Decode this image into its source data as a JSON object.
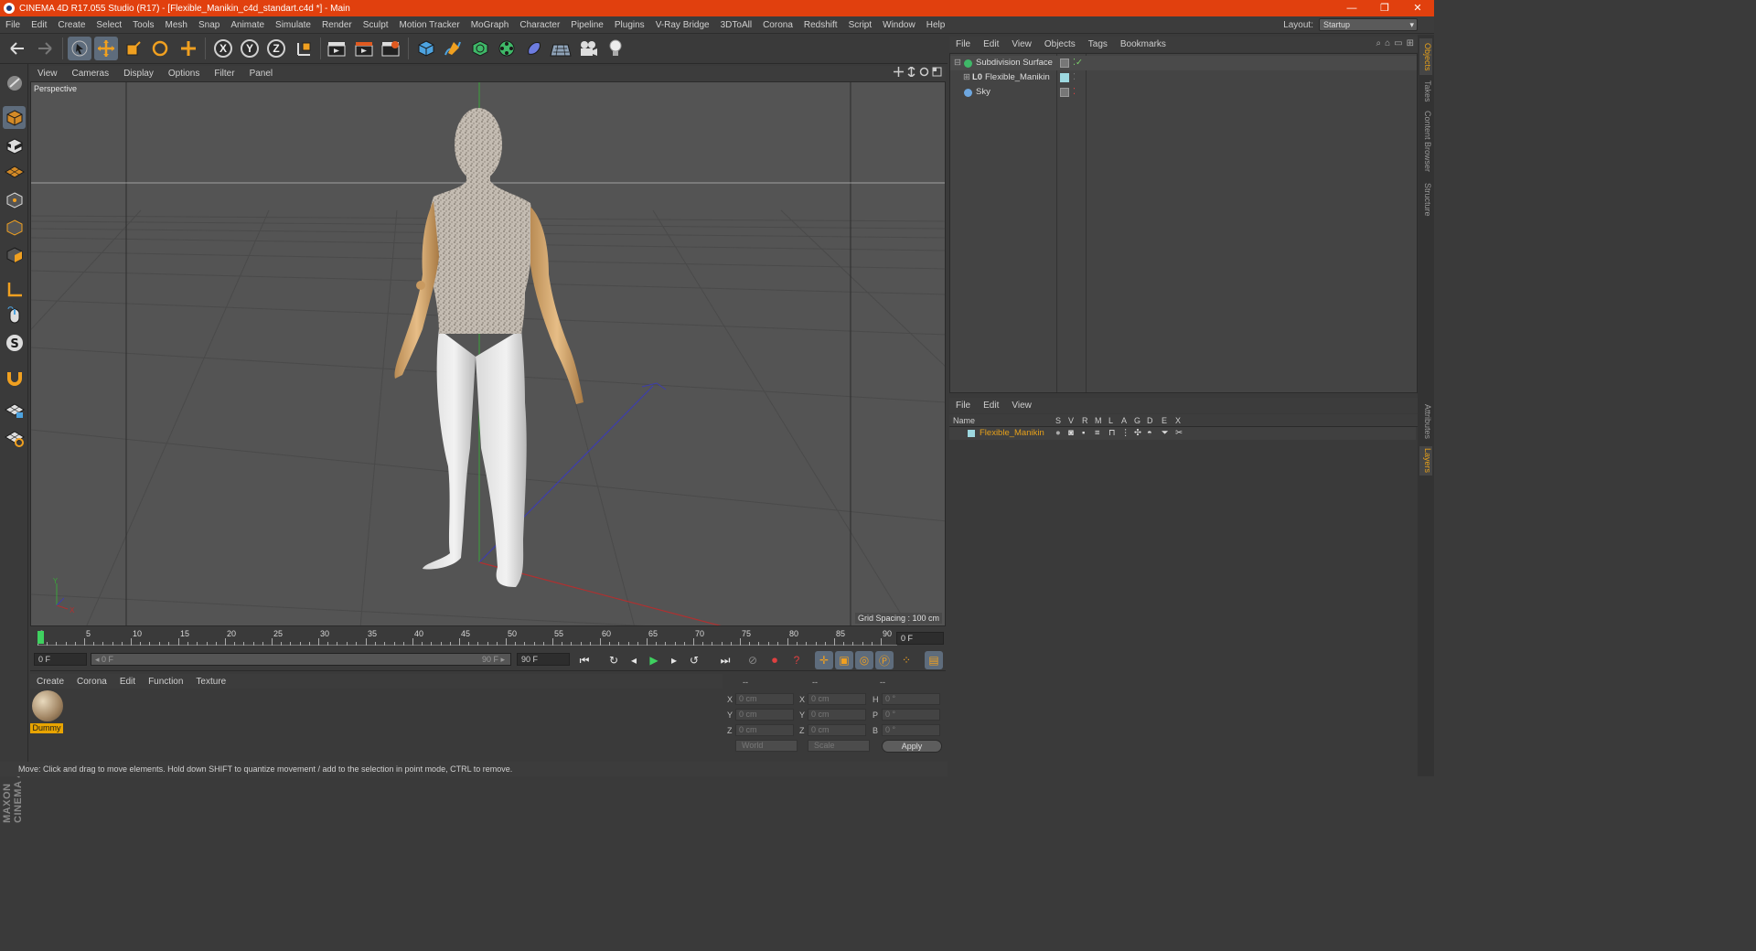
{
  "window": {
    "title": "CINEMA 4D R17.055 Studio (R17) - [Flexible_Manikin_c4d_standart.c4d *] - Main",
    "minimize": "—",
    "restore": "❐",
    "close": "✕"
  },
  "menu": [
    "File",
    "Edit",
    "Create",
    "Select",
    "Tools",
    "Mesh",
    "Snap",
    "Animate",
    "Simulate",
    "Render",
    "Sculpt",
    "Motion Tracker",
    "MoGraph",
    "Character",
    "Pipeline",
    "Plugins",
    "V-Ray Bridge",
    "3DToAll",
    "Corona",
    "Redshift",
    "Script",
    "Window",
    "Help"
  ],
  "layout": {
    "label": "Layout:",
    "value": "Startup"
  },
  "axis_buttons": [
    "X",
    "Y",
    "Z"
  ],
  "viewport": {
    "menu": [
      "View",
      "Cameras",
      "Display",
      "Options",
      "Filter",
      "Panel"
    ],
    "label": "Perspective",
    "grid_spacing": "Grid Spacing : 100 cm",
    "axis_y": "Y",
    "axis_x": "X"
  },
  "timeline": {
    "ticks": [
      "0",
      "5",
      "10",
      "15",
      "20",
      "25",
      "30",
      "35",
      "40",
      "45",
      "50",
      "55",
      "60",
      "65",
      "70",
      "75",
      "80",
      "85",
      "90"
    ],
    "current": "0 F"
  },
  "transport": {
    "start": "0 F",
    "range_start": "◂ 0 F",
    "range_end": "90 F ▸",
    "end": "90 F"
  },
  "material_manager": {
    "menu": [
      "Create",
      "Corona",
      "Edit",
      "Function",
      "Texture"
    ],
    "material": "Dummy"
  },
  "coordinates": {
    "header": [
      "--",
      "--",
      "--"
    ],
    "rows": [
      {
        "a": "X",
        "av": "0 cm",
        "b": "X",
        "bv": "0 cm",
        "c": "H",
        "cv": "0 °"
      },
      {
        "a": "Y",
        "av": "0 cm",
        "b": "Y",
        "bv": "0 cm",
        "c": "P",
        "cv": "0 °"
      },
      {
        "a": "Z",
        "av": "0 cm",
        "b": "Z",
        "bv": "0 cm",
        "c": "B",
        "cv": "0 °"
      }
    ],
    "space": "World",
    "mode": "Scale",
    "apply": "Apply"
  },
  "status": "Move: Click and drag to move elements. Hold down SHIFT to quantize movement / add to the selection in point mode, CTRL to remove.",
  "branding": "MAXON CINEMA 4D",
  "object_manager": {
    "menu": [
      "File",
      "Edit",
      "View",
      "Objects",
      "Tags",
      "Bookmarks"
    ],
    "objects": [
      "Subdivision Surface",
      "Flexible_Manikin",
      "Sky"
    ]
  },
  "layer_manager": {
    "menu": [
      "File",
      "Edit",
      "View"
    ],
    "columns": [
      "Name",
      "S",
      "V",
      "R",
      "M",
      "L",
      "A",
      "G",
      "D",
      "E",
      "X"
    ],
    "layers": [
      "Flexible_Manikin"
    ]
  },
  "right_tabs": [
    "Objects",
    "Takes",
    "Content Browser",
    "Structure",
    "Attributes",
    "Layers"
  ],
  "colors": {
    "accent": "#e1400e",
    "selected": "#5e6c7c",
    "material": "#e8a400"
  }
}
